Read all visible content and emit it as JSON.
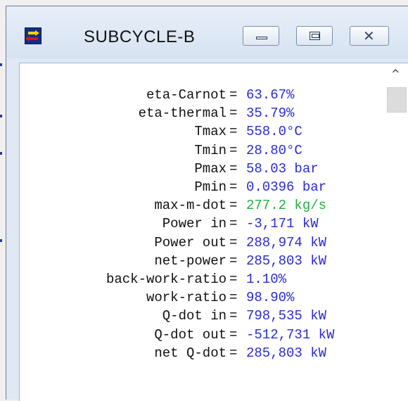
{
  "window": {
    "title": "SUBCYCLE-B",
    "icon": "app-cycle-icon",
    "controls": {
      "minimize": "minimize-icon",
      "maximize": "maximize-icon",
      "close": "close-icon"
    }
  },
  "results": [
    {
      "label": "eta-Carnot",
      "value": "63.67%"
    },
    {
      "label": "eta-thermal",
      "value": "35.79%"
    },
    {
      "label": "Tmax",
      "value": "558.0°C"
    },
    {
      "label": "Tmin",
      "value": "28.80°C"
    },
    {
      "label": "Pmax",
      "value": "58.03 bar"
    },
    {
      "label": "Pmin",
      "value": "0.0396 bar"
    },
    {
      "label": "max-m-dot",
      "value": "277.2 kg/s",
      "color": "#22b040"
    },
    {
      "label": "Power in",
      "value": "-3,171 kW"
    },
    {
      "label": "Power out",
      "value": "288,974 kW"
    },
    {
      "label": "net-power",
      "value": "285,803 kW"
    },
    {
      "label": "back-work-ratio",
      "value": "1.10%"
    },
    {
      "label": "work-ratio",
      "value": "98.90%"
    },
    {
      "label": "Q-dot in",
      "value": "798,535 kW"
    },
    {
      "label": "Q-dot out",
      "value": "-512,731 kW"
    },
    {
      "label": "net Q-dot",
      "value": "285,803 kW"
    }
  ],
  "scrollbar": {
    "up_arrow": "^"
  },
  "colors": {
    "value": "#2b2bd6",
    "highlight": "#22b040"
  }
}
